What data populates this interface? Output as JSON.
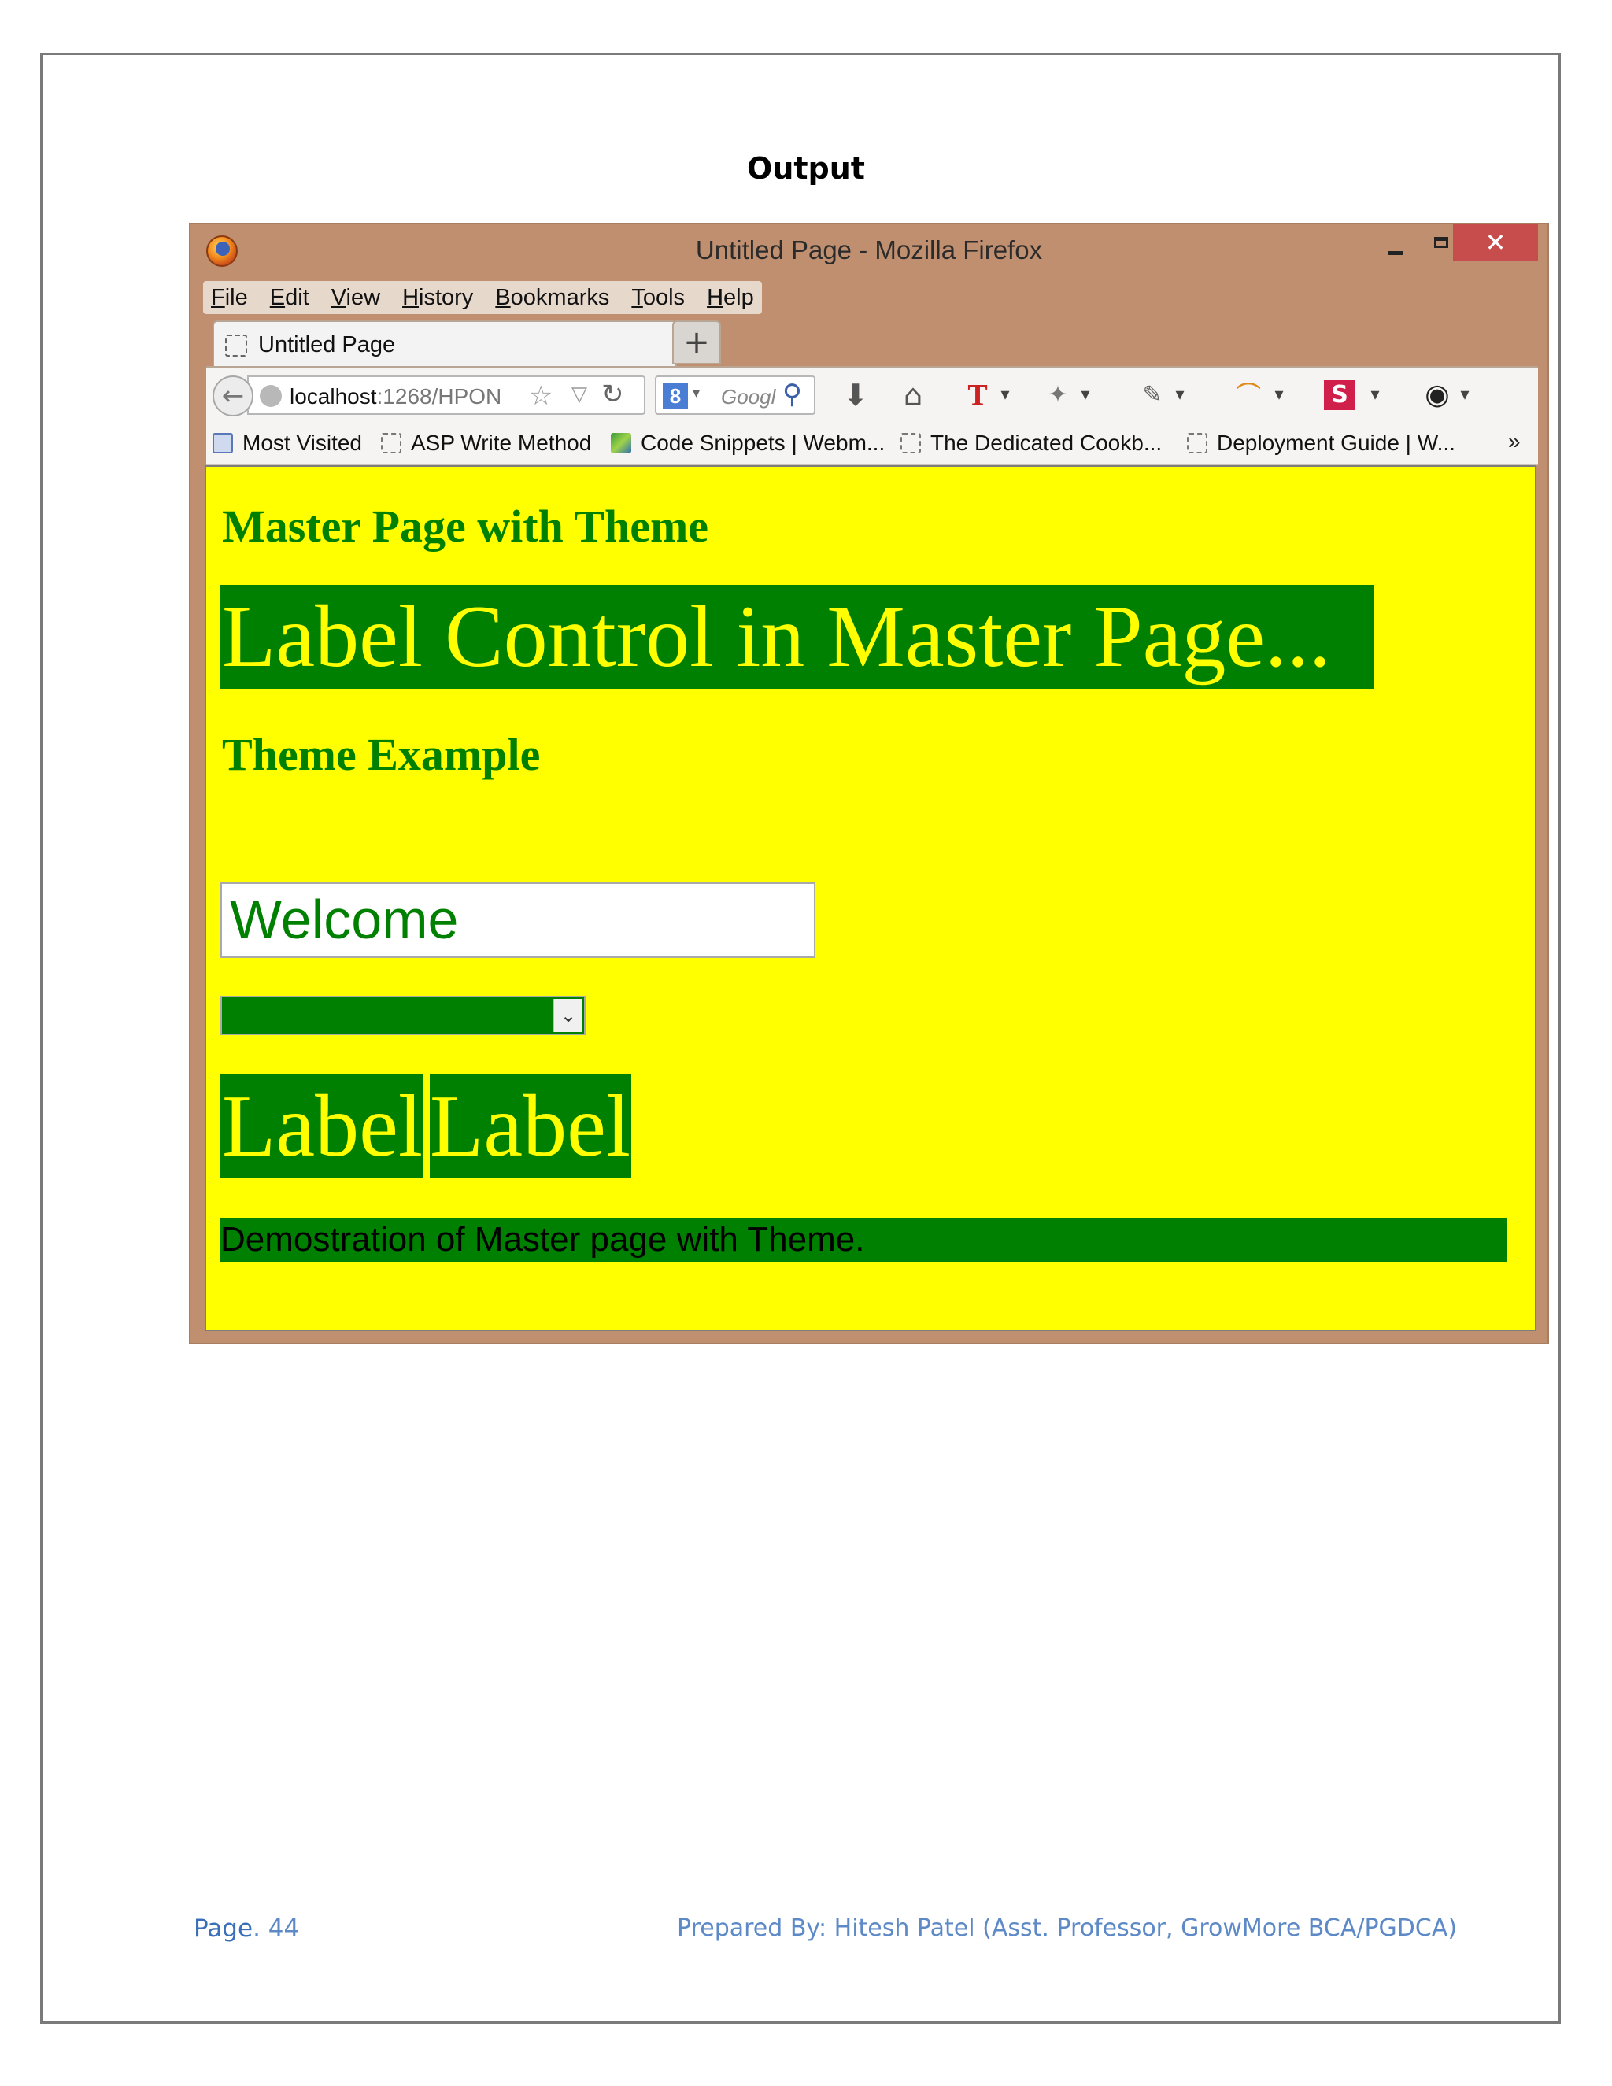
{
  "document": {
    "heading": "Output"
  },
  "browser": {
    "window_title": "Untitled Page - Mozilla Firefox",
    "close_glyph": "✕",
    "menu": [
      "File",
      "Edit",
      "View",
      "History",
      "Bookmarks",
      "Tools",
      "Help"
    ],
    "tab_label": "Untitled Page",
    "new_tab_glyph": "+",
    "url_host": "localhost",
    "url_path": ":1268/HPON",
    "search_placeholder": "Google",
    "bookmarks": {
      "most_visited": "Most Visited",
      "asp_write": "ASP Write Method",
      "code_snippets": "Code Snippets | Webm...",
      "dedicated": "The Dedicated Cookb...",
      "deployment": "Deployment Guide | W...",
      "more": "»"
    }
  },
  "page": {
    "title": "Master Page with Theme",
    "label_master": "Label Control in Master Page...",
    "theme_title": "Theme Example",
    "textbox_value": "Welcome",
    "label_1": "Label",
    "label_2": "Label",
    "demo_text": "Demostration of Master page with Theme.",
    "colors": {
      "background": "#ffff00",
      "accent": "#008000"
    }
  },
  "footer": {
    "page_word": "Page",
    "page_number": ". 44",
    "prepared_by": "Prepared By: Hitesh Patel (Asst. Professor, GrowMore BCA/PGDCA)"
  }
}
